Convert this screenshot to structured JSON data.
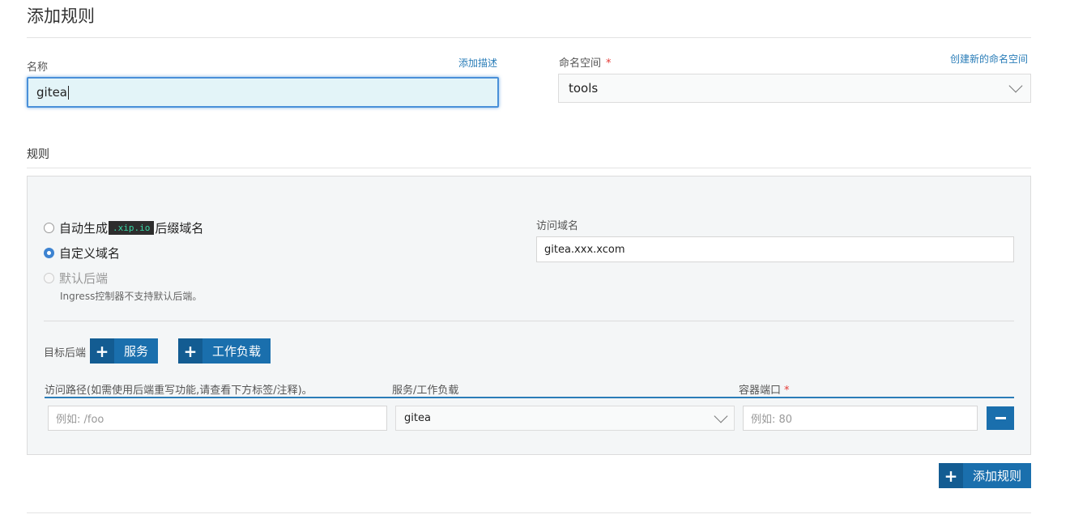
{
  "page": {
    "title": "添加规则"
  },
  "name_field": {
    "label": "名称",
    "add_description_link": "添加描述",
    "value": "gitea"
  },
  "namespace_field": {
    "label": "命名空间",
    "required_mark": "*",
    "create_link": "创建新的命名空间",
    "value": "tools"
  },
  "rules": {
    "section_title": "规则",
    "host_options": {
      "auto_prefix": "自动生成",
      "auto_code": ".xip.io",
      "auto_suffix": "后缀域名",
      "custom": "自定义域名",
      "default_backend": "默认后端",
      "default_backend_note": "Ingress控制器不支持默认后端。",
      "selected": "custom"
    },
    "hostname": {
      "label": "访问域名",
      "value": "gitea.xxx.xcom"
    },
    "target": {
      "label": "目标后端",
      "service_button": "服务",
      "workload_button": "工作负载"
    },
    "table": {
      "headers": {
        "path": "访问路径(如需使用后端重写功能,请查看下方标签/注释)。",
        "service": "服务/工作负载",
        "port": "容器端口",
        "port_required": "*"
      },
      "row": {
        "path_placeholder": "例如: /foo",
        "service_value": "gitea",
        "port_placeholder": "例如: 80"
      }
    },
    "add_rule_button": "添加规则"
  }
}
